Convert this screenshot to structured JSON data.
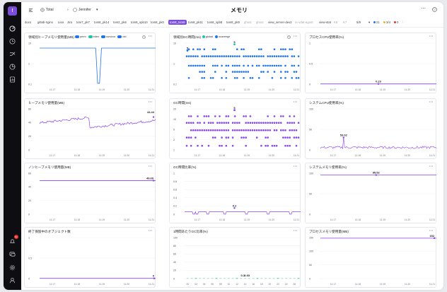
{
  "header": {
    "title": "メモリ",
    "crumb1": "Total",
    "crumb2": "Jennifer"
  },
  "tabs": [
    {
      "label": "docs"
    },
    {
      "label": "gitlab-nginx"
    },
    {
      "label": "Lisa"
    },
    {
      "label": "Jira"
    },
    {
      "label": "tom7_pk7"
    },
    {
      "label": "tom8_pk14"
    },
    {
      "label": "tom2_pk6"
    },
    {
      "label": "tom8_spb10"
    },
    {
      "label": "tom8_pk0"
    },
    {
      "label": "tom8_tom8"
    },
    {
      "label": "tom8_pk11"
    },
    {
      "label": "tom8_spb8"
    },
    {
      "label": "tom8_pk9"
    },
    {
      "label": "ghost"
    },
    {
      "label": "ghost"
    },
    {
      "label": "view_server-dev2"
    },
    {
      "label": "re-vdat-agent"
    },
    {
      "label": "view-stat"
    },
    {
      "label": "K8"
    },
    {
      "label": "K7"
    }
  ],
  "filters": {
    "page": "5/9",
    "count1": "21",
    "count2": "3/4",
    "count3": "0"
  },
  "colors": {
    "accent": "#7c4ddb",
    "blue": "#1e74e8",
    "purple": "#8a45f0",
    "teal": "#22c3a6",
    "gold": "#e6b437",
    "red": "#e3342f"
  },
  "icons": [
    "grid-icon",
    "globe-icon",
    "dashboard-icon",
    "clock-icon",
    "flow-icon",
    "pie-icon",
    "report-icon",
    "bell-icon",
    "chat-icon",
    "gear-icon",
    "user-icon"
  ],
  "rail_badge": "9+",
  "xticks": [
    "11:17",
    "11:18",
    "11:19",
    "11:20",
    "11:21"
  ],
  "panels": {
    "heap_young": {
      "title": "領域別ヒープメモリ使用量(MB)",
      "legend": [
        "perm",
        "eden",
        "survivor",
        "old"
      ]
    },
    "gc_count": {
      "title": "領域別GC時間(ms)",
      "legend": [
        "global",
        "scavenge"
      ]
    },
    "process_cpu": {
      "title": "プロセスCPU使用率(%)"
    },
    "heap_used": {
      "title": "ヒープメモリ使用量(MB)"
    },
    "gc_time": {
      "title": "GC時間(ms)"
    },
    "system_cpu": {
      "title": "システムCPU使用率(%)"
    },
    "nonheap": {
      "title": "ノンヒープメモリ使用量(MB)"
    },
    "gc_ratio": {
      "title": "GC時間比率(%)"
    },
    "system_mem": {
      "title": "システムメモリ使用率(%)"
    },
    "finalize": {
      "title": "終了保留中のオブジェクト数"
    },
    "gc_per_min": {
      "title": "1時間あたりGC比率(%)"
    },
    "process_mem": {
      "title": "プロセスメモリ使用量(MB)"
    }
  },
  "chart_data": [
    {
      "type": "line",
      "title": "領域別ヒープメモリ使用量(MB)",
      "yticks": [
        "10",
        "1",
        "0.1"
      ],
      "series": [
        {
          "name": "perm",
          "values": [
            7,
            7,
            7,
            0.1,
            7,
            7,
            7
          ]
        }
      ]
    },
    {
      "type": "scatter",
      "title": "領域別GC時間(ms)",
      "yticks": [
        "10",
        "1",
        "0.1"
      ],
      "annotations": [
        "5",
        "5"
      ]
    },
    {
      "type": "line",
      "title": "プロセスCPU使用率(%)",
      "yticks": [
        "1",
        "0.5",
        "0"
      ],
      "annotations": [
        "0.23"
      ],
      "values": [
        0.23
      ]
    },
    {
      "type": "line",
      "title": "ヒープメモリ使用量(MB)",
      "yticks": [
        "60",
        "40",
        "20",
        "0"
      ],
      "annotations": [
        "44.44"
      ]
    },
    {
      "type": "scatter",
      "title": "GC時間(ms)",
      "yticks": [
        "20",
        "10",
        "5",
        "2",
        "1"
      ],
      "annotations": [
        "5"
      ]
    },
    {
      "type": "line",
      "title": "システムCPU使用率(%)",
      "yticks": [
        "100",
        "50",
        "0"
      ],
      "annotations": [
        "53.02"
      ]
    },
    {
      "type": "line",
      "title": "ノンヒープメモリ使用量(MB)",
      "yticks": [
        "60",
        "40",
        "20",
        "0"
      ],
      "annotations": [
        "49.69"
      ]
    },
    {
      "type": "line",
      "title": "GC時間比率(%)",
      "yticks": [
        "1",
        "0.8",
        "0.6",
        "0.4",
        "0.2",
        "0"
      ],
      "annotations": [
        "0.2"
      ]
    },
    {
      "type": "line",
      "title": "システムメモリ使用率(%)",
      "yticks": [
        "100",
        "50",
        "0"
      ],
      "annotations": [
        "95.52"
      ]
    },
    {
      "type": "line",
      "title": "終了保留中のオブジェクト数",
      "yticks": [
        "1",
        "0.5",
        "0"
      ],
      "annotations": [
        "0"
      ]
    },
    {
      "type": "bar",
      "title": "1時間あたりGC比率(%)",
      "yticks": [
        "100",
        "80",
        "60",
        "40",
        "20",
        "0"
      ],
      "annotations": [
        "0.1",
        "0.03"
      ]
    },
    {
      "type": "line",
      "title": "プロセスメモリ使用量(MB)",
      "yticks": [
        "150",
        "100",
        "50",
        "0"
      ],
      "annotations": [
        "152"
      ]
    }
  ]
}
